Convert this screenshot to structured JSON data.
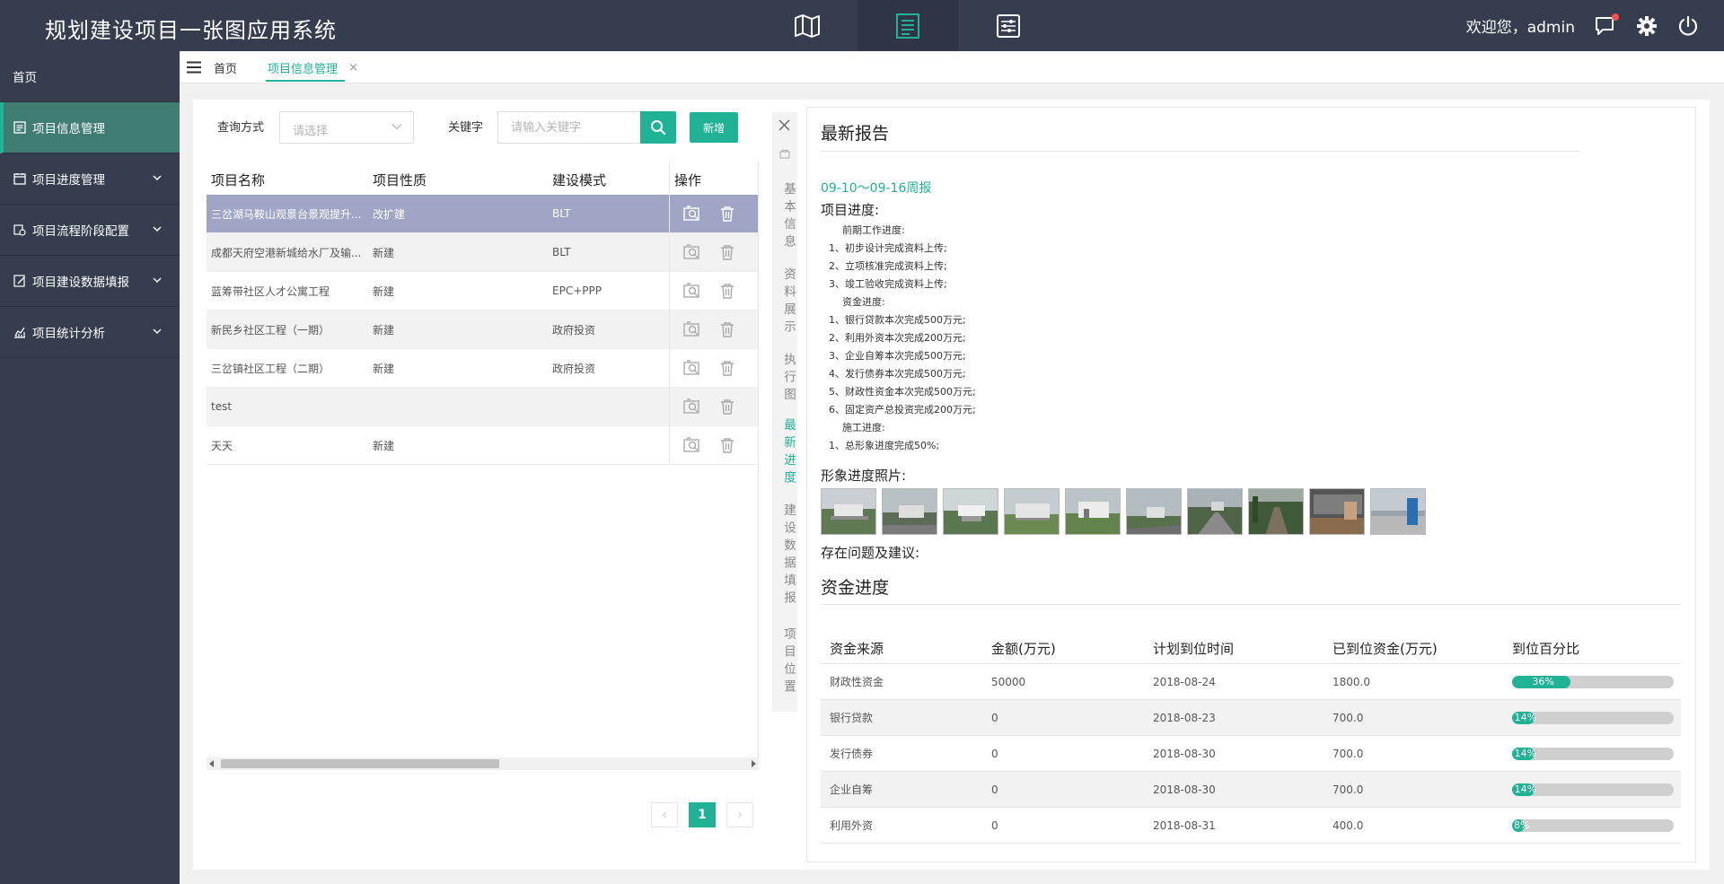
{
  "app": {
    "title": "规划建设项目一张图应用系统"
  },
  "topnav": {
    "items": [
      {
        "icon": "map-icon"
      },
      {
        "icon": "list-doc-icon",
        "active": true
      },
      {
        "icon": "sliders-icon"
      }
    ]
  },
  "user": {
    "greeting": "欢迎您，admin"
  },
  "sidebar": {
    "home": "首页",
    "items": [
      {
        "label": "项目信息管理",
        "icon": "doc-icon",
        "active": true
      },
      {
        "label": "项目进度管理",
        "icon": "calendar-icon"
      },
      {
        "label": "项目流程阶段配置",
        "icon": "settings-icon"
      },
      {
        "label": "项目建设数据填报",
        "icon": "edit-icon"
      },
      {
        "label": "项目统计分析",
        "icon": "chart-icon"
      }
    ]
  },
  "tabs": {
    "home": "首页",
    "current": "项目信息管理",
    "close": "×"
  },
  "search": {
    "query_label": "查询方式",
    "query_placeholder": "请选择",
    "keyword_label": "关键字",
    "keyword_placeholder": "请输入关键字",
    "add_label": "新增"
  },
  "project_table": {
    "columns": [
      "项目名称",
      "项目性质",
      "建设模式",
      "操作"
    ],
    "rows": [
      [
        "三岔湖马鞍山观景台景观提升...",
        "改扩建",
        "BLT"
      ],
      [
        "成都天府空港新城给水厂及输...",
        "新建",
        "BLT"
      ],
      [
        "蓝筹带社区人才公寓工程",
        "新建",
        "EPC+PPP"
      ],
      [
        "新民乡社区工程（一期）",
        "新建",
        "政府投资"
      ],
      [
        "三岔镇社区工程（二期）",
        "新建",
        "政府投资"
      ],
      [
        "test",
        "",
        ""
      ],
      [
        "天天",
        "新建",
        ""
      ]
    ]
  },
  "pagination": {
    "prev": "‹",
    "current": "1",
    "next": "›"
  },
  "detail_tabs": [
    "基本信息",
    "资料展示",
    "执行图",
    "最新进度",
    "建设数据填报",
    "项目位置"
  ],
  "report": {
    "title": "最新报告",
    "week": "09-10～09-16周报",
    "progress_title": "项目进度:",
    "lines": [
      {
        "text": "前期工作进度:",
        "indent": 2
      },
      {
        "text": "1、初步设计完成资料上传;",
        "indent": 1
      },
      {
        "text": "2、立项核准完成资料上传;",
        "indent": 1
      },
      {
        "text": "3、竣工验收完成资料上传;",
        "indent": 1
      },
      {
        "text": "资金进度:",
        "indent": 2
      },
      {
        "text": "1、银行贷款本次完成500万元;",
        "indent": 1
      },
      {
        "text": "2、利用外资本次完成200万元;",
        "indent": 1
      },
      {
        "text": "3、企业自筹本次完成500万元;",
        "indent": 1
      },
      {
        "text": "4、发行债券本次完成500万元;",
        "indent": 1
      },
      {
        "text": "5、财政性资金本次完成500万元;",
        "indent": 1
      },
      {
        "text": "6、固定资产总投资完成200万元;",
        "indent": 1
      },
      {
        "text": "施工进度:",
        "indent": 2
      },
      {
        "text": "1、总形象进度完成50%;",
        "indent": 1
      }
    ],
    "photos_title": "形象进度照片:",
    "issues_title": "存在问题及建议:",
    "funds_title": "资金进度"
  },
  "funds_table": {
    "columns": [
      "资金来源",
      "金额(万元)",
      "计划到位时间",
      "已到位资金(万元)",
      "到位百分比"
    ],
    "rows": [
      {
        "source": "财政性资金",
        "amount": "50000",
        "date": "2018-08-24",
        "arrived": "1800.0",
        "percent": 36,
        "percent_label": "36%"
      },
      {
        "source": "银行贷款",
        "amount": "0",
        "date": "2018-08-23",
        "arrived": "700.0",
        "percent": 14,
        "percent_label": "14%"
      },
      {
        "source": "发行债券",
        "amount": "0",
        "date": "2018-08-30",
        "arrived": "700.0",
        "percent": 14,
        "percent_label": "14%"
      },
      {
        "source": "企业自筹",
        "amount": "0",
        "date": "2018-08-30",
        "arrived": "700.0",
        "percent": 14,
        "percent_label": "14%"
      },
      {
        "source": "利用外资",
        "amount": "0",
        "date": "2018-08-31",
        "arrived": "400.0",
        "percent": 8,
        "percent_label": "8%"
      }
    ]
  },
  "colors": {
    "accent": "#20b294",
    "header_bg": "#363d4f",
    "selected_row": "#a0a5c5"
  }
}
